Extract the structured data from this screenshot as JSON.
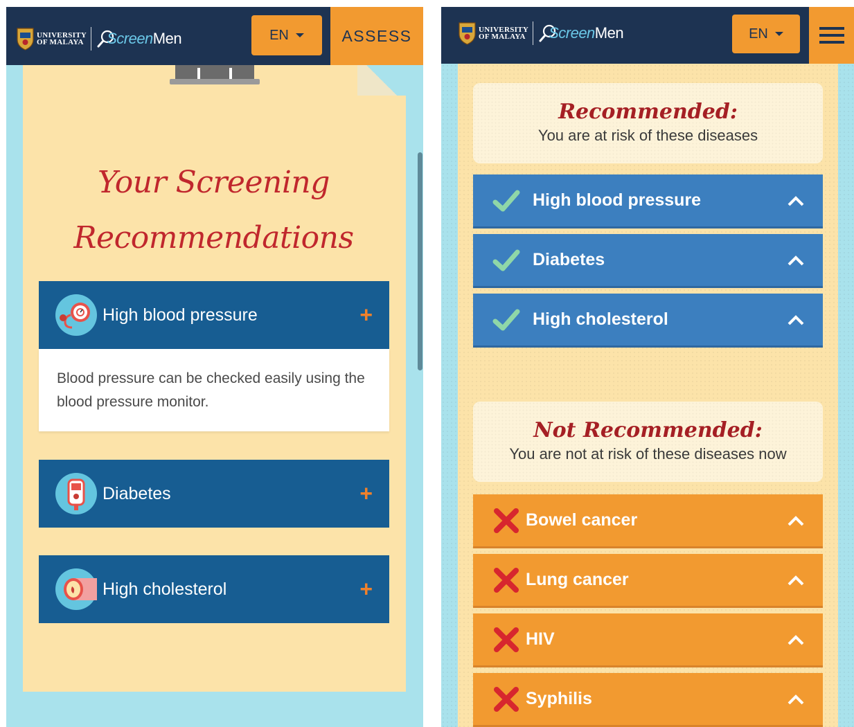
{
  "brand": {
    "university_line1": "UNIVERSITY",
    "university_line2": "OF MALAYA",
    "app_name_part1": "Screen",
    "app_name_part2": "Men"
  },
  "left_screen": {
    "language": "EN",
    "assess_label": "ASSESS",
    "title_line1": "Your Screening",
    "title_line2": "Recommendations",
    "items": [
      {
        "label": "High blood pressure",
        "icon": "blood-pressure-monitor-icon",
        "expanded": true,
        "description": "Blood pressure can be checked easily using the blood pressure monitor."
      },
      {
        "label": "Diabetes",
        "icon": "glucose-meter-icon",
        "expanded": false
      },
      {
        "label": "High cholesterol",
        "icon": "artery-cholesterol-icon",
        "expanded": false
      }
    ],
    "toggle_symbol": "+"
  },
  "right_screen": {
    "language": "EN",
    "recommended": {
      "title": "Recommended:",
      "subtitle": "You are at risk of these diseases",
      "items": [
        "High blood pressure",
        "Diabetes",
        "High cholesterol"
      ]
    },
    "not_recommended": {
      "title": "Not Recommended:",
      "subtitle": "You are not at risk of these diseases now",
      "items": [
        "Bowel cancer",
        "Lung cancer",
        "HIV",
        "Syphilis"
      ]
    }
  },
  "colors": {
    "navbar": "#1d3352",
    "accent_orange": "#f29a30",
    "paper": "#fce3a9",
    "accordion_blue": "#175d92",
    "recommended_blue": "#3c7fbf",
    "title_red": "#c0272d",
    "check_green": "#8fd7a8",
    "cross_red": "#d7262e"
  }
}
